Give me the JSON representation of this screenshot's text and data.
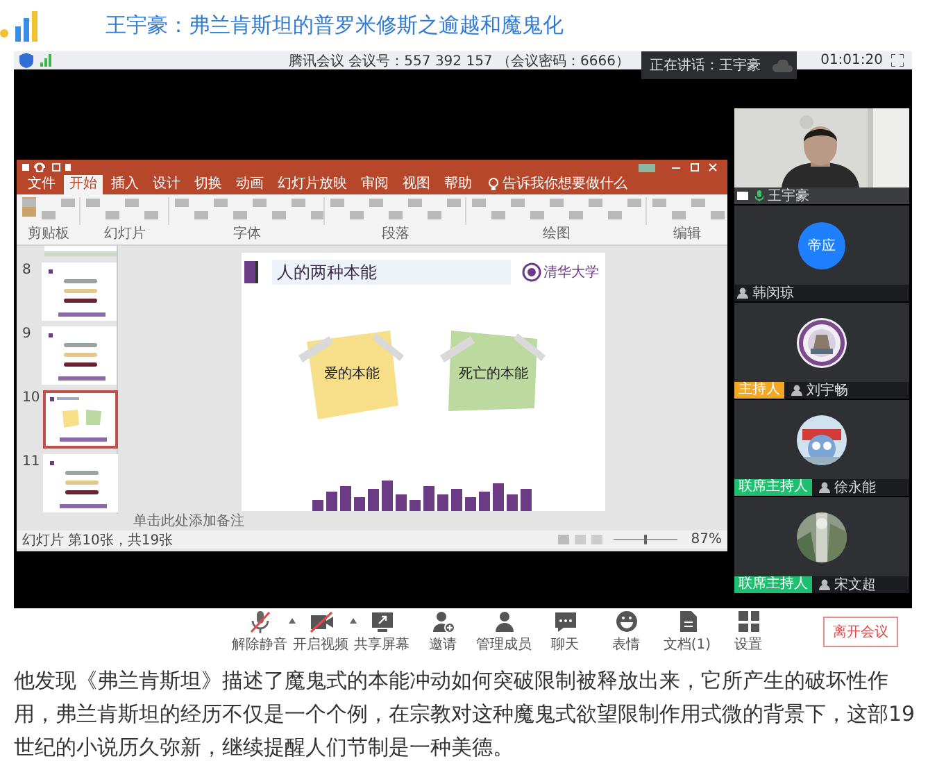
{
  "article": {
    "title": "王宇豪：弗兰肯斯坦的普罗米修斯之逾越和魔鬼化"
  },
  "meeting": {
    "header": "腾讯会议 会议号：557 392 157 （会议密码：6666）",
    "speaking": "正在讲话：王宇豪",
    "timer": "01:01:20"
  },
  "ppt": {
    "tabs": [
      {
        "label": "文件",
        "selected": false
      },
      {
        "label": "开始",
        "selected": true
      },
      {
        "label": "插入",
        "selected": false
      },
      {
        "label": "设计",
        "selected": false
      },
      {
        "label": "切换",
        "selected": false
      },
      {
        "label": "动画",
        "selected": false
      },
      {
        "label": "幻灯片放映",
        "selected": false
      },
      {
        "label": "审阅",
        "selected": false
      },
      {
        "label": "视图",
        "selected": false
      },
      {
        "label": "帮助",
        "selected": false
      }
    ],
    "tell_me": "告诉我你想要做什么",
    "ribbon_groups": [
      "剪贴板",
      "幻灯片",
      "字体",
      "段落",
      "绘图",
      "编辑"
    ],
    "thumbnails": [
      {
        "number": "8",
        "selected": false
      },
      {
        "number": "9",
        "selected": false
      },
      {
        "number": "10",
        "selected": true
      },
      {
        "number": "11",
        "selected": false
      }
    ],
    "slide": {
      "title": "人的两种本能",
      "logo_text": "清华大学",
      "notes": [
        {
          "text": "爱的本能",
          "color": "#f7df8a"
        },
        {
          "text": "死亡的本能",
          "color": "#bcd99f"
        }
      ]
    },
    "notes_placeholder": "单击此处添加备注",
    "status": "幻灯片 第10张，共19张",
    "zoom": "87%"
  },
  "participants": [
    {
      "kind": "video",
      "name": "王宇豪"
    },
    {
      "kind": "initials",
      "avatar_text": "帝应",
      "name": "韩闵琼"
    },
    {
      "kind": "picture",
      "role": {
        "label": "主持人",
        "color": "#f2a823"
      },
      "name": "刘宇畅"
    },
    {
      "kind": "picture",
      "role": {
        "label": "联席主持人",
        "color": "#1fbf72"
      },
      "name": "徐永能"
    },
    {
      "kind": "picture",
      "role": {
        "label": "联席主持人",
        "color": "#1fbf72"
      },
      "name": "宋文超"
    }
  ],
  "toolbar": [
    {
      "kind": "mic",
      "label": "解除静音",
      "has_menu": true
    },
    {
      "kind": "camera",
      "label": "开启视频",
      "has_menu": true
    },
    {
      "kind": "share",
      "label": "共享屏幕",
      "has_menu": false
    },
    {
      "kind": "invite",
      "label": "邀请",
      "has_menu": false
    },
    {
      "kind": "members",
      "label": "管理成员",
      "has_menu": false
    },
    {
      "kind": "chat",
      "label": "聊天",
      "has_menu": false
    },
    {
      "kind": "emoji",
      "label": "表情",
      "has_menu": false
    },
    {
      "kind": "doc",
      "label": "文档(1)",
      "has_menu": false
    },
    {
      "kind": "settings",
      "label": "设置",
      "has_menu": false
    }
  ],
  "leave": "离开会议",
  "body": "他发现《弗兰肯斯坦》描述了魔鬼式的本能冲动如何突破限制被释放出来，它所产生的破坏性作用，弗兰肯斯坦的经历不仅是一个个例，在宗教对这种魔鬼式欲望限制作用式微的背景下，这部19世纪的小说历久弥新，继续提醒人们节制是一种美德。"
}
